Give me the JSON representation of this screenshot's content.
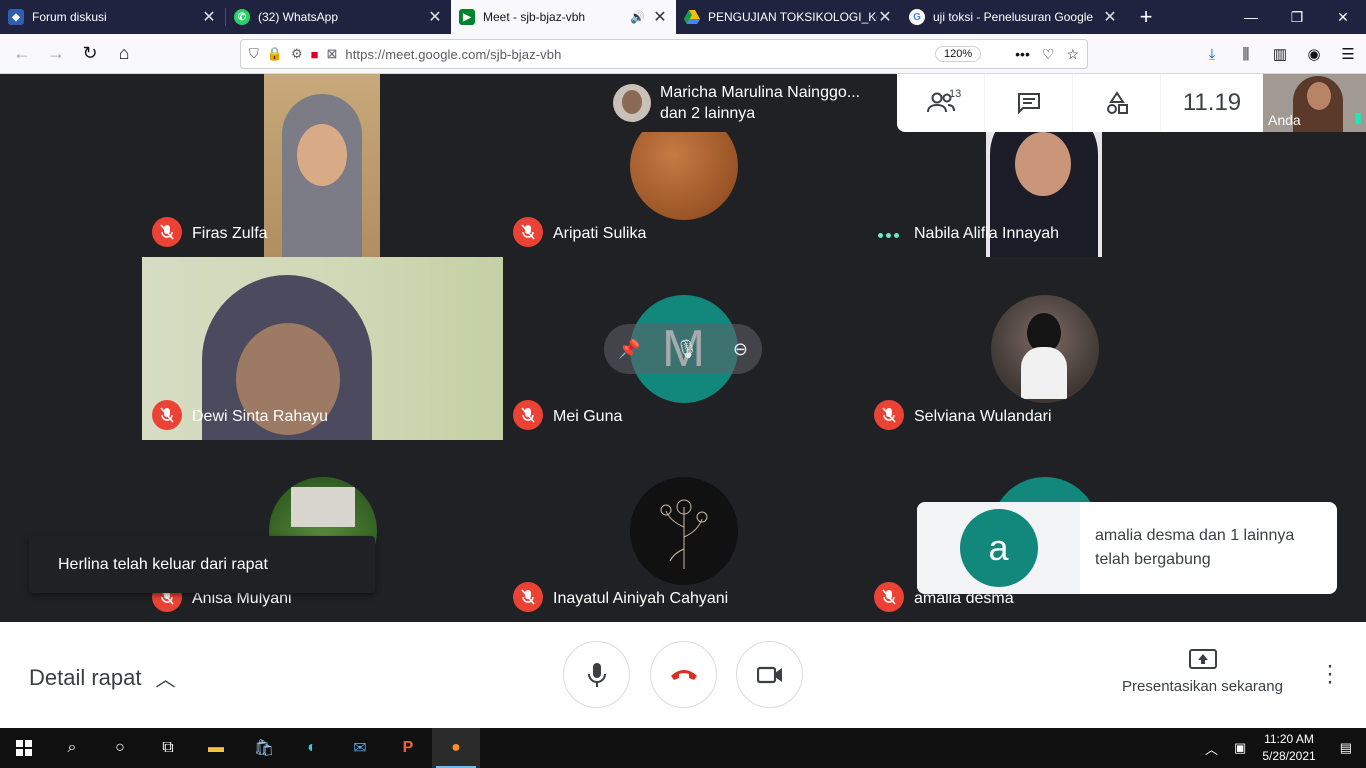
{
  "browser": {
    "tabs": [
      {
        "title": "Forum diskusi",
        "icon": "moodle-icon",
        "active": false
      },
      {
        "title": "(32) WhatsApp",
        "icon": "whatsapp-icon",
        "active": false
      },
      {
        "title": "Meet - sjb-bjaz-vbh",
        "icon": "meet-icon",
        "active": true
      },
      {
        "title": "PENGUJIAN TOKSIKOLOGI_Kelo",
        "icon": "drive-icon",
        "active": false
      },
      {
        "title": "uji toksi - Penelusuran Google",
        "icon": "google-icon",
        "active": false
      }
    ],
    "url": "https://meet.google.com/sjb-bjaz-vbh",
    "zoom": "120%"
  },
  "meet": {
    "speaker_chip": {
      "line1": "Maricha Marulina Nainggo...",
      "line2": "dan 2 lainnya"
    },
    "participants_count": "13",
    "clock": "11.19",
    "self_label": "Anda",
    "tiles": [
      {
        "name": "Firas Zulfa",
        "state": "muted"
      },
      {
        "name": "Aripati Sulika",
        "state": "muted"
      },
      {
        "name": "Nabila Alifia Innayah",
        "state": "speaking"
      },
      {
        "name": "Dewi Sinta Rahayu",
        "state": "muted"
      },
      {
        "name": "Mei Guna",
        "state": "muted",
        "initial": "M"
      },
      {
        "name": "Selviana Wulandari",
        "state": "muted"
      },
      {
        "name": "Anisa Mulyani",
        "state": "muted"
      },
      {
        "name": "Inayatul Ainiyah Cahyani",
        "state": "muted"
      },
      {
        "name": "amalia desma",
        "state": "muted"
      }
    ],
    "toast_left": "Herlina telah keluar dari rapat",
    "toast_right": {
      "initial": "a",
      "line1": "amalia desma dan 1 lainnya",
      "line2": "telah bergabung"
    },
    "details_label": "Detail rapat",
    "present_label": "Presentasikan sekarang"
  },
  "taskbar": {
    "time": "11:20 AM",
    "date": "5/28/2021"
  },
  "colors": {
    "mute_red": "#ea4335",
    "meet_bg": "#202124",
    "avatar_teal": "#12877b",
    "hangup_red": "#d93025"
  }
}
